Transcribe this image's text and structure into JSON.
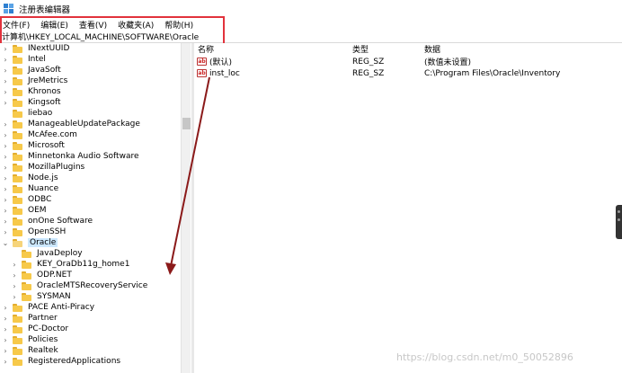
{
  "window": {
    "title": "注册表编辑器"
  },
  "menu": [
    "文件(F)",
    "编辑(E)",
    "查看(V)",
    "收藏夹(A)",
    "帮助(H)"
  ],
  "address": "计算机\\HKEY_LOCAL_MACHINE\\SOFTWARE\\Oracle",
  "tree": [
    {
      "label": "INextUUID"
    },
    {
      "label": "Intel"
    },
    {
      "label": "JavaSoft"
    },
    {
      "label": "JreMetrics"
    },
    {
      "label": "Khronos"
    },
    {
      "label": "Kingsoft"
    },
    {
      "label": "liebao"
    },
    {
      "label": "ManageableUpdatePackage"
    },
    {
      "label": "McAfee.com"
    },
    {
      "label": "Microsoft"
    },
    {
      "label": "Minnetonka Audio Software"
    },
    {
      "label": "MozillaPlugins"
    },
    {
      "label": "Node.js"
    },
    {
      "label": "Nuance"
    },
    {
      "label": "ODBC"
    },
    {
      "label": "OEM"
    },
    {
      "label": "onOne Software"
    },
    {
      "label": "OpenSSH"
    },
    {
      "label": "Oracle"
    },
    {
      "label": "JavaDeploy"
    },
    {
      "label": "KEY_OraDb11g_home1"
    },
    {
      "label": "ODP.NET"
    },
    {
      "label": "OracleMTSRecoveryService"
    },
    {
      "label": "SYSMAN"
    },
    {
      "label": "PACE Anti-Piracy"
    },
    {
      "label": "Partner"
    },
    {
      "label": "PC-Doctor"
    },
    {
      "label": "Policies"
    },
    {
      "label": "Realtek"
    },
    {
      "label": "RegisteredApplications"
    }
  ],
  "columns": {
    "name": "名称",
    "type": "类型",
    "data": "数据"
  },
  "values": [
    {
      "name": "(默认)",
      "type": "REG_SZ",
      "data": "(数值未设置)",
      "icon": "ab-string-icon"
    },
    {
      "name": "inst_loc",
      "type": "REG_SZ",
      "data": "C:\\Program Files\\Oracle\\Inventory",
      "icon": "ab-string-icon"
    }
  ],
  "watermark": "https://blog.csdn.net/m0_50052896",
  "colors": {
    "highlight": "#e2323c",
    "selection": "#cce8ff",
    "folder": "#f7c94a"
  }
}
